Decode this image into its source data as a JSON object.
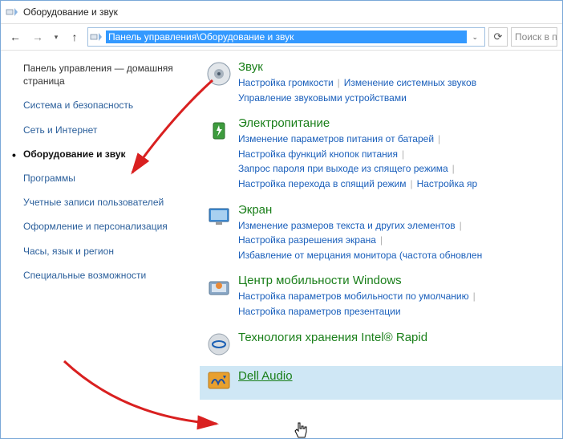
{
  "window": {
    "title": "Оборудование и звук"
  },
  "nav": {
    "path": "Панель управления\\Оборудование и звук"
  },
  "search": {
    "placeholder": "Поиск в п"
  },
  "sidebar": {
    "home": "Панель управления — домашняя страница",
    "items": [
      {
        "label": "Система и безопасность"
      },
      {
        "label": "Сеть и Интернет"
      },
      {
        "label": "Оборудование и звук",
        "active": true
      },
      {
        "label": "Программы"
      },
      {
        "label": "Учетные записи пользователей"
      },
      {
        "label": "Оформление и персонализация"
      },
      {
        "label": "Часы, язык и регион"
      },
      {
        "label": "Специальные возможности"
      }
    ]
  },
  "categories": [
    {
      "icon": "sound",
      "title": "Звук",
      "links": [
        "Настройка громкости",
        "Изменение системных звуков",
        "Управление звуковыми устройствами"
      ]
    },
    {
      "icon": "power",
      "title": "Электропитание",
      "links": [
        "Изменение параметров питания от батарей",
        "Настройка функций кнопок питания",
        "Запрос пароля при выходе из спящего режима",
        "Настройка перехода в спящий режим",
        "Настройка яр"
      ]
    },
    {
      "icon": "display",
      "title": "Экран",
      "links": [
        "Изменение размеров текста и других элементов",
        "Настройка разрешения экрана",
        "Избавление от мерцания монитора (частота обновлен"
      ]
    },
    {
      "icon": "mobility",
      "title": "Центр мобильности Windows",
      "links": [
        "Настройка параметров мобильности по умолчанию",
        "Настройка параметров презентации"
      ]
    },
    {
      "icon": "intel",
      "title": "Технология хранения Intel® Rapid",
      "links": []
    },
    {
      "icon": "dell",
      "title": "Dell Audio",
      "links": [],
      "highlight": true,
      "underline": true
    }
  ]
}
